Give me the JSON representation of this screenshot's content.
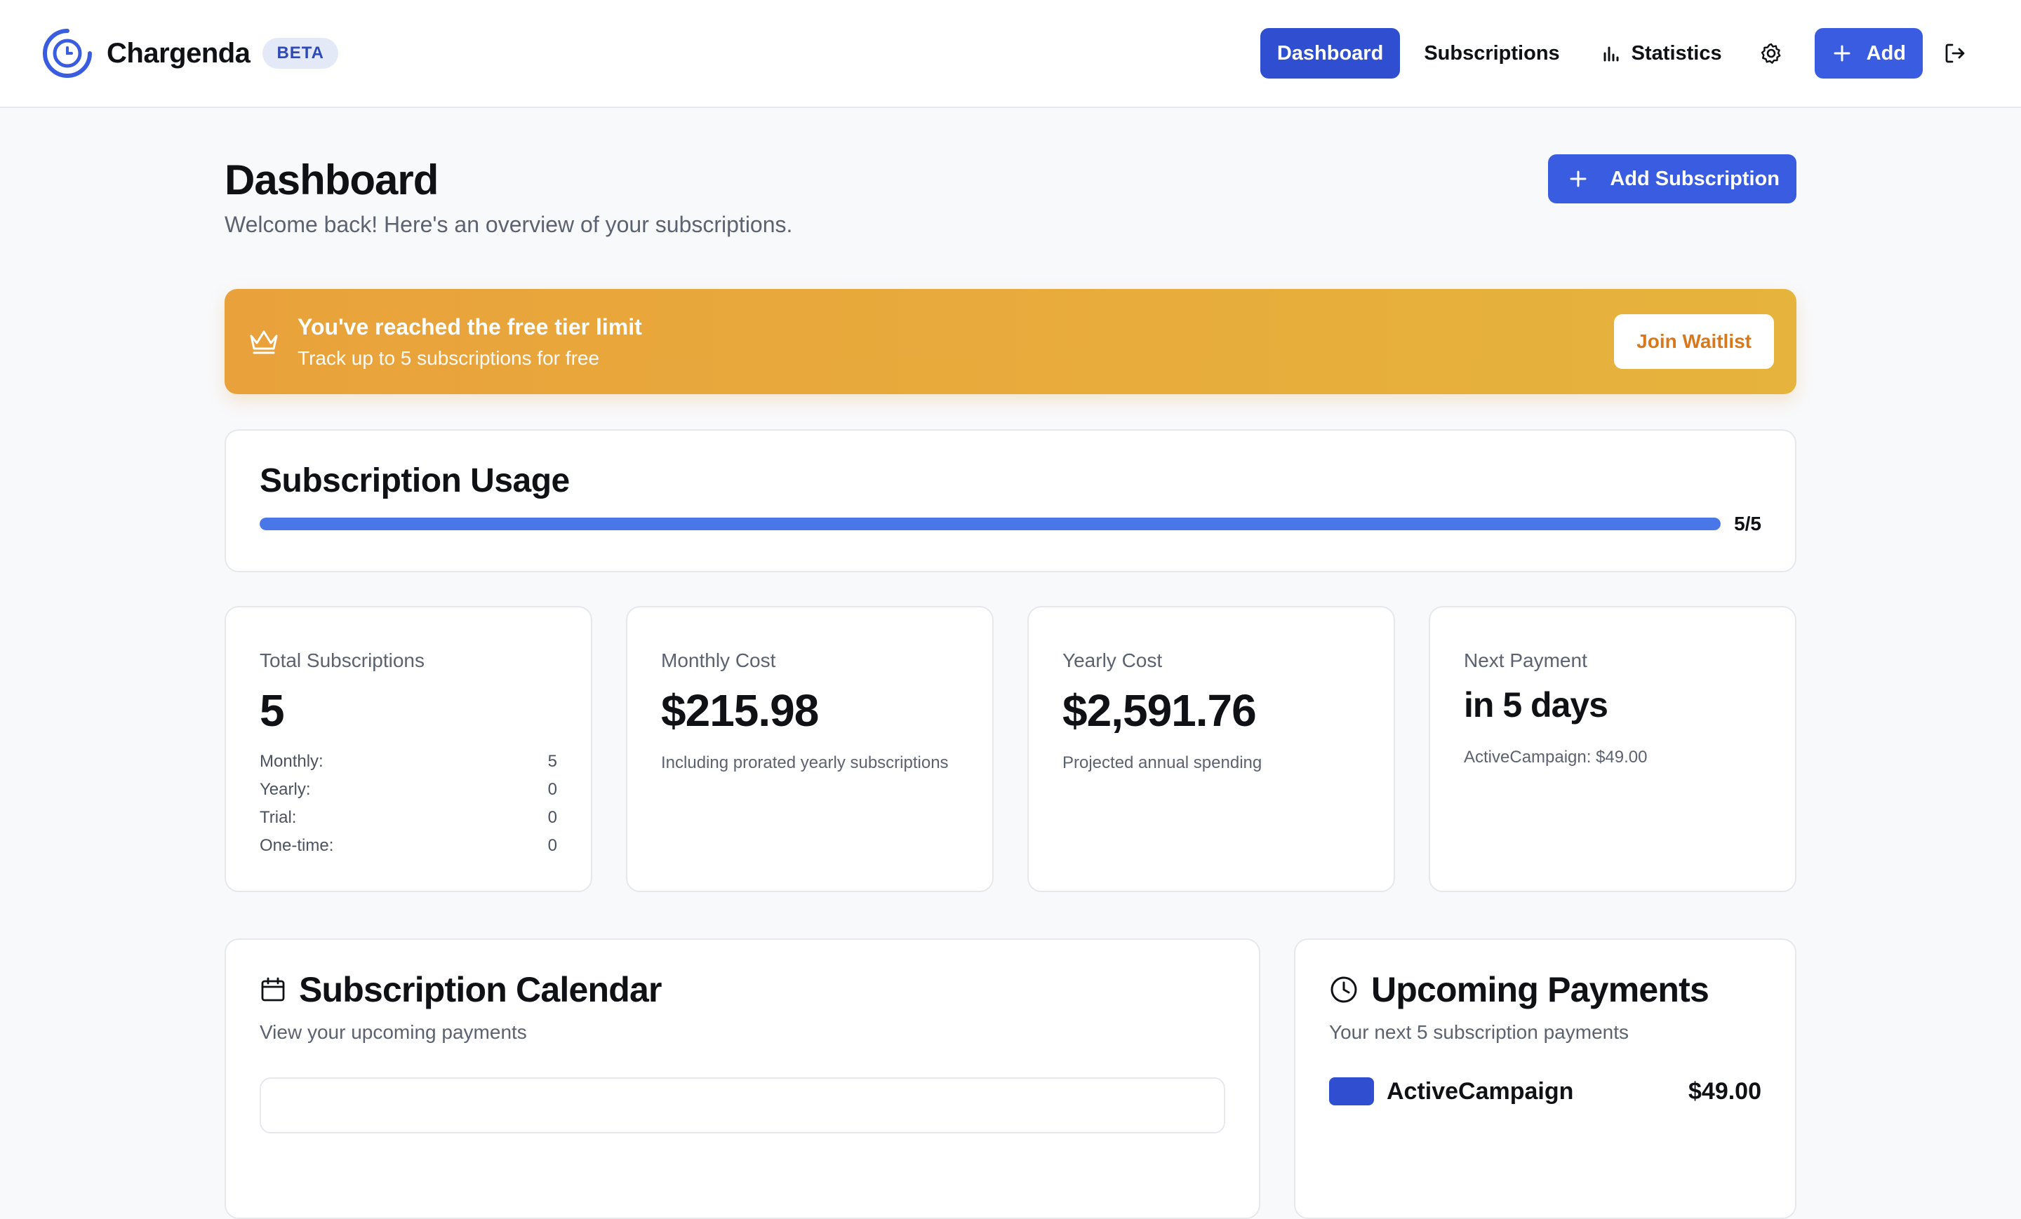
{
  "app": {
    "name": "Chargenda",
    "badge": "BETA"
  },
  "nav": {
    "items": [
      {
        "label": "Dashboard",
        "active": true
      },
      {
        "label": "Subscriptions",
        "active": false
      },
      {
        "label": "Statistics",
        "active": false,
        "icon": "bar-chart-icon"
      }
    ],
    "settings_icon": "gear-icon",
    "add_label": "Add",
    "logout_icon": "logout-icon"
  },
  "page": {
    "title": "Dashboard",
    "subtitle": "Welcome back! Here's an overview of your subscriptions.",
    "add_subscription_label": "Add Subscription"
  },
  "banner": {
    "title": "You've reached the free tier limit",
    "subtitle": "Track up to 5 subscriptions for free",
    "button": "Join Waitlist",
    "icon": "crown-icon"
  },
  "usage": {
    "title": "Subscription Usage",
    "count": "5/5",
    "fraction": 1.0
  },
  "stats": {
    "total": {
      "label": "Total Subscriptions",
      "value": "5",
      "breakdown": [
        {
          "label": "Monthly:",
          "value": "5"
        },
        {
          "label": "Yearly:",
          "value": "0"
        },
        {
          "label": "Trial:",
          "value": "0"
        },
        {
          "label": "One-time:",
          "value": "0"
        }
      ]
    },
    "monthly": {
      "label": "Monthly Cost",
      "value": "$215.98",
      "note": "Including prorated yearly subscriptions"
    },
    "yearly": {
      "label": "Yearly Cost",
      "value": "$2,591.76",
      "note": "Projected annual spending"
    },
    "next": {
      "label": "Next Payment",
      "value": "in 5 days",
      "note": "ActiveCampaign: $49.00"
    }
  },
  "calendar": {
    "title": "Subscription Calendar",
    "subtitle": "View your upcoming payments",
    "icon": "calendar-icon"
  },
  "upcoming": {
    "title": "Upcoming Payments",
    "subtitle": "Your next 5 subscription payments",
    "icon": "clock-icon",
    "first": {
      "name": "ActiveCampaign",
      "amount": "$49.00"
    }
  },
  "colors": {
    "accent": "#3a5ce0",
    "banner_start": "#e9a23b",
    "banner_end": "#e6b33c",
    "progress": "#4a77e8"
  }
}
